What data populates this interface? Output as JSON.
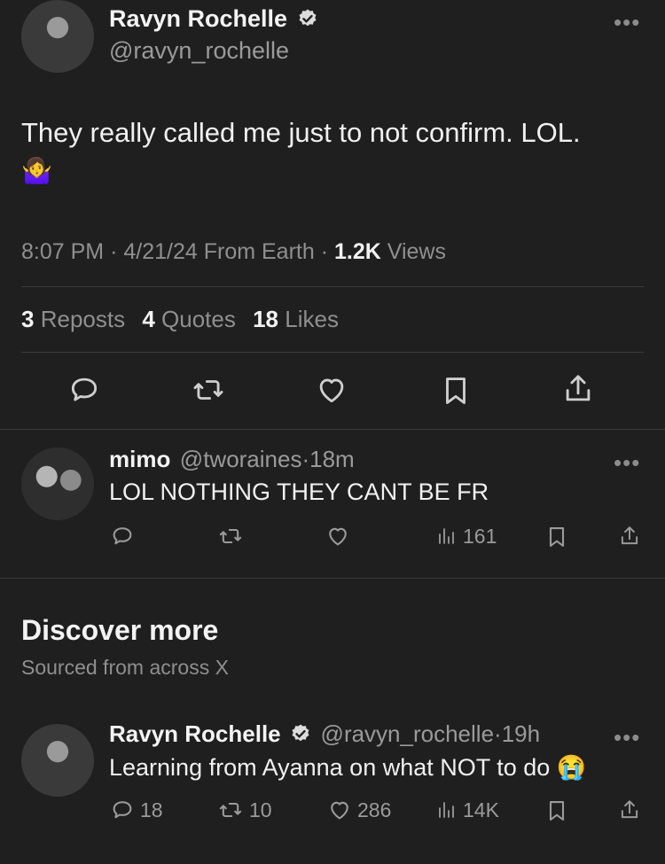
{
  "main_tweet": {
    "author_name": "Ravyn Rochelle",
    "author_handle": "@ravyn_rochelle",
    "text": "They really called me just to not confirm. LOL.",
    "emoji": "🤷‍♀️",
    "time": "8:07 PM",
    "date": "4/21/24",
    "source": "From Earth",
    "views_count": "1.2K",
    "views_label": "Views",
    "reposts_count": "3",
    "reposts_label": "Reposts",
    "quotes_count": "4",
    "quotes_label": "Quotes",
    "likes_count": "18",
    "likes_label": "Likes"
  },
  "reply": {
    "author_name": "mimo",
    "author_handle": "@tworaines",
    "age": "18m",
    "text": "LOL NOTHING THEY CANT BE FR",
    "views": "161"
  },
  "discover": {
    "title": "Discover more",
    "subtitle": "Sourced from across X"
  },
  "discover_tweet": {
    "author_name": "Ravyn Rochelle",
    "author_handle": "@ravyn_rochelle",
    "age": "19h",
    "text": "Learning from Ayanna on what NOT to do",
    "emoji": "😭",
    "replies": "18",
    "reposts": "10",
    "likes": "286",
    "views": "14K"
  },
  "separator": "·",
  "more_glyph": "•••",
  "icons": [
    "reply-icon",
    "repost-icon",
    "like-icon",
    "bookmark-icon",
    "share-icon",
    "views-icon",
    "verified-icon",
    "more-icon"
  ],
  "colors": {
    "background": "#1f1f1f",
    "text": "#e9e9e9",
    "muted": "#8f8f8f",
    "divider": "#3a3a3a"
  }
}
